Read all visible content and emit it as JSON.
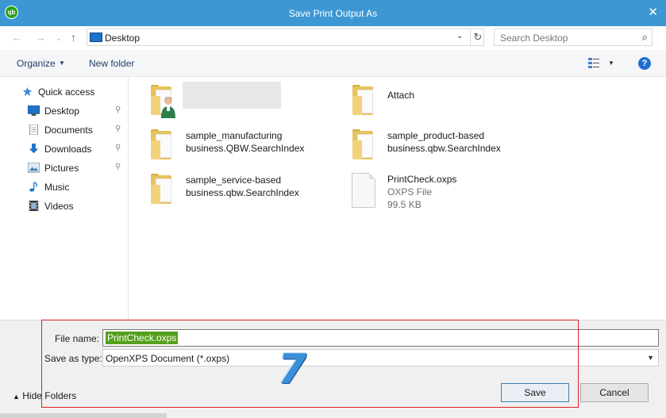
{
  "window": {
    "title": "Save Print Output As",
    "app_icon_text": "qb",
    "close_glyph": "✕"
  },
  "nav": {
    "back_glyph": "←",
    "forward_glyph": "→",
    "recent_glyph": "⌄",
    "up_glyph": "↑",
    "address": "Desktop",
    "address_chevron": "⌄",
    "refresh_glyph": "↻",
    "search_placeholder": "Search Desktop",
    "search_glyph": "⌕"
  },
  "toolbar": {
    "organize": "Organize",
    "organize_caret": "▼",
    "new_folder": "New folder",
    "view_caret": "▼",
    "help": "?"
  },
  "sidebar": {
    "items": [
      {
        "label": "Quick access",
        "icon": "star-icon",
        "pinned": false
      },
      {
        "label": "Desktop",
        "icon": "desktop-icon",
        "pinned": true
      },
      {
        "label": "Documents",
        "icon": "documents-icon",
        "pinned": true
      },
      {
        "label": "Downloads",
        "icon": "downloads-icon",
        "pinned": true
      },
      {
        "label": "Pictures",
        "icon": "pictures-icon",
        "pinned": true
      },
      {
        "label": "Music",
        "icon": "music-icon",
        "pinned": false
      },
      {
        "label": "Videos",
        "icon": "videos-icon",
        "pinned": false
      }
    ],
    "pin_glyph": "📌"
  },
  "files": [
    {
      "name_line1": "",
      "name_line2": "",
      "type": "user-folder"
    },
    {
      "name_line1": "Attach",
      "name_line2": "",
      "type": "folder"
    },
    {
      "name_line1": "sample_manufacturing",
      "name_line2": "business.QBW.SearchIndex",
      "type": "folder"
    },
    {
      "name_line1": "sample_product-based",
      "name_line2": "business.qbw.SearchIndex",
      "type": "folder"
    },
    {
      "name_line1": "sample_service-based",
      "name_line2": "business.qbw.SearchIndex",
      "type": "folder"
    },
    {
      "name_line1": "PrintCheck.oxps",
      "name_line2": "OXPS File",
      "name_line3": "99.5 KB",
      "type": "file"
    }
  ],
  "form": {
    "file_name_label": "File name:",
    "file_name_value": "PrintCheck.oxps",
    "save_type_label": "Save as type:",
    "save_type_value": "OpenXPS Document (*.oxps)",
    "save_type_caret": "▼"
  },
  "footer": {
    "hide_folders": "Hide Folders",
    "hide_caret": "▲",
    "save": "Save",
    "cancel": "Cancel"
  },
  "annotation": {
    "step_number": "7",
    "color": "#3a8fd6",
    "outline_color": "#e02020"
  },
  "colors": {
    "titlebar": "#3d97d3",
    "selection_green": "#54a01c",
    "folder": "#e6c35c"
  }
}
